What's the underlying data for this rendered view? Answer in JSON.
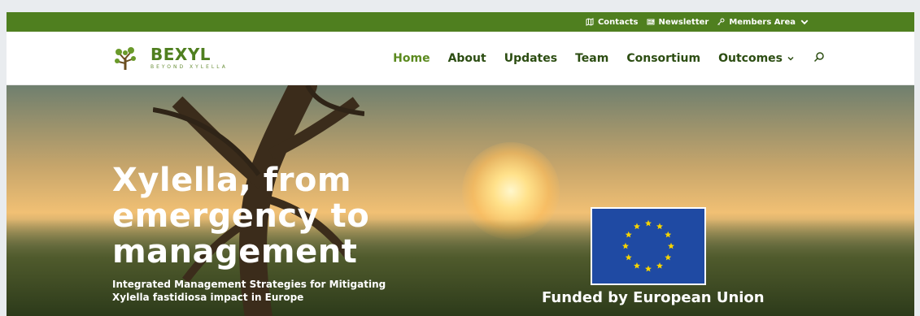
{
  "colors": {
    "topbar_bg": "#4f7f1f",
    "nav_text": "#2c4d12",
    "nav_active": "#5b8a1f",
    "eu_blue": "#1f4aa3",
    "eu_star": "#f5d300"
  },
  "topbar": {
    "contacts": "Contacts",
    "newsletter": "Newsletter",
    "members_area": "Members Area"
  },
  "brand": {
    "name": "BEXYL",
    "subtitle": "BEYOND XYLELLA"
  },
  "nav": {
    "items": [
      "Home",
      "About",
      "Updates",
      "Team",
      "Consortium",
      "Outcomes"
    ]
  },
  "hero": {
    "title_lines": [
      "Xylella, from",
      "emergency to",
      "management"
    ],
    "subtitle_lines": [
      "Integrated Management Strategies for Mitigating",
      "Xylella fastidiosa impact in Europe"
    ]
  },
  "eu": {
    "funded_label": "Funded by European Union"
  },
  "icons": [
    "map-icon",
    "newsletter-icon",
    "key-icon",
    "chevron-down-icon",
    "search-icon",
    "bexyl-logo-icon",
    "eu-flag-icon"
  ]
}
